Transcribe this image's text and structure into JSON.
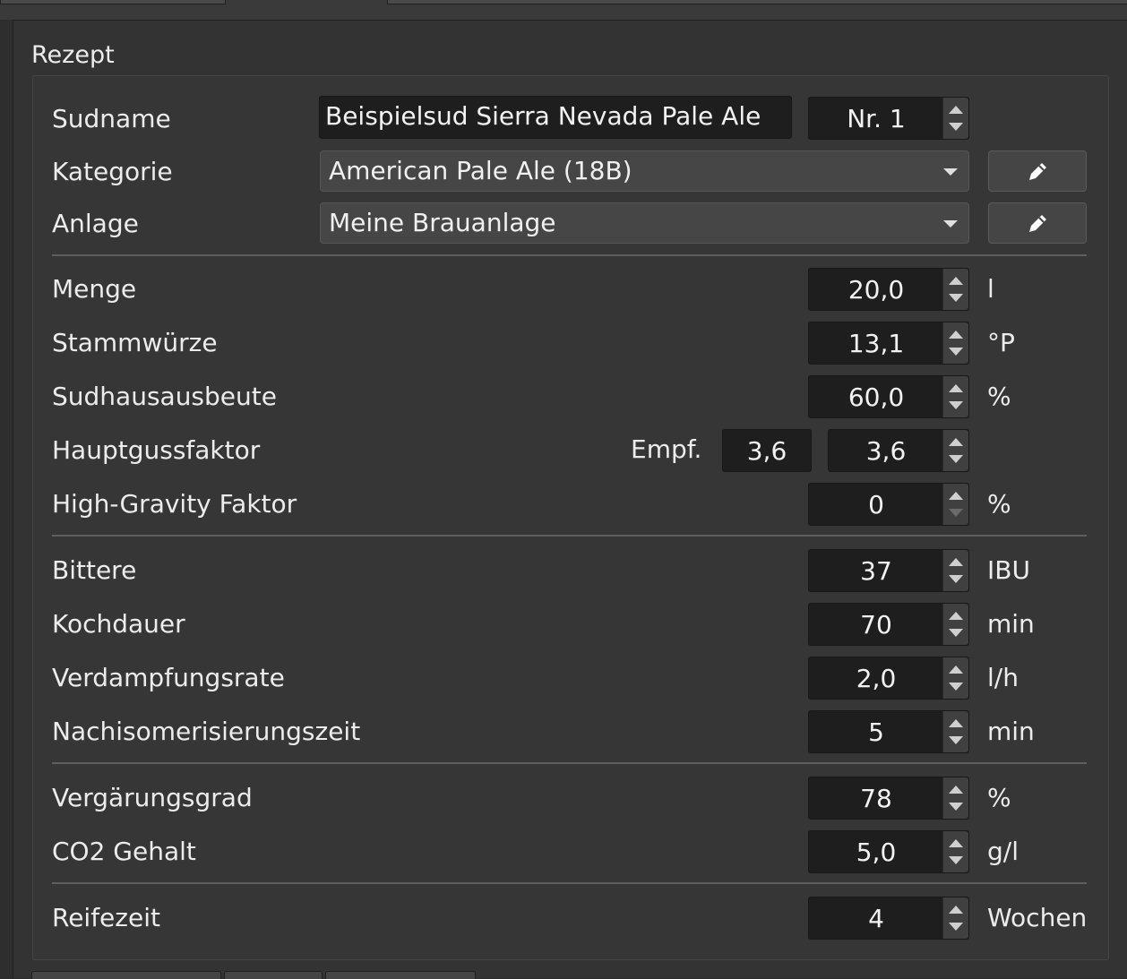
{
  "group": {
    "title": "Rezept"
  },
  "sudname": {
    "label": "Sudname",
    "value": "Beispielsud Sierra Nevada Pale Ale",
    "nr_value": "Nr. 1"
  },
  "kategorie": {
    "label": "Kategorie",
    "value": "American Pale Ale (18B)"
  },
  "anlage": {
    "label": "Anlage",
    "value": "Meine Brauanlage"
  },
  "menge": {
    "label": "Menge",
    "value": "20,0",
    "unit": "l"
  },
  "stammwuerze": {
    "label": "Stammwürze",
    "value": "13,1",
    "unit": "°P"
  },
  "sudhausausbeute": {
    "label": "Sudhausausbeute",
    "value": "60,0",
    "unit": "%"
  },
  "hauptgussfaktor": {
    "label": "Hauptgussfaktor",
    "empf_label": "Empf.",
    "empf_value": "3,6",
    "value": "3,6"
  },
  "high_gravity": {
    "label": "High-Gravity Faktor",
    "value": "0",
    "unit": "%"
  },
  "bittere": {
    "label": "Bittere",
    "value": "37",
    "unit": "IBU"
  },
  "kochdauer": {
    "label": "Kochdauer",
    "value": "70",
    "unit": "min"
  },
  "verdampfungsrate": {
    "label": "Verdampfungsrate",
    "value": "2,0",
    "unit": "l/h"
  },
  "nachisomerisierungszeit": {
    "label": "Nachisomerisierungszeit",
    "value": "5",
    "unit": "min"
  },
  "vergaerungsgrad": {
    "label": "Vergärungsgrad",
    "value": "78",
    "unit": "%"
  },
  "co2": {
    "label": "CO2 Gehalt",
    "value": "5,0",
    "unit": "g/l"
  },
  "reifezeit": {
    "label": "Reifezeit",
    "value": "4",
    "unit": "Wochen"
  },
  "icons": {
    "edit": "pencil-icon",
    "spin_up": "arrow-up-icon",
    "spin_down": "arrow-down-icon",
    "dropdown": "chevron-down-icon"
  },
  "colors": {
    "background": "#2b2b2b",
    "panel": "#363636",
    "field": "#1e1e1e",
    "text": "#ececec"
  }
}
